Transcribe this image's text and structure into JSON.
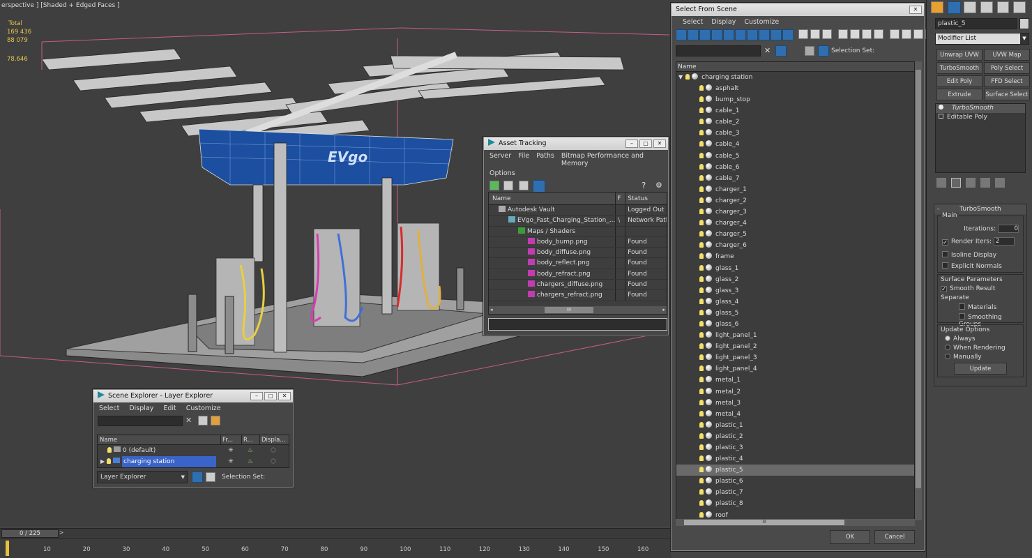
{
  "viewport": {
    "label": "erspective ] [Shaded + Edged Faces ]",
    "stats": {
      "total_label": "Total",
      "polys": "169 436",
      "verts": "88 079"
    },
    "fps": "78.646",
    "brand_text": "EVgo"
  },
  "timeline": {
    "frame": "0 / 225",
    "next": ">",
    "ticks": [
      "10",
      "20",
      "30",
      "40",
      "50",
      "60",
      "70",
      "80",
      "90",
      "100",
      "110",
      "120",
      "130",
      "140",
      "150",
      "160"
    ]
  },
  "scene_explorer": {
    "title": "Scene Explorer - Layer Explorer",
    "menu": [
      "Select",
      "Display",
      "Edit",
      "Customize"
    ],
    "headers": [
      "Name",
      "Fr...",
      "R...",
      "Displa..."
    ],
    "rows": [
      {
        "name": "0 (default)"
      },
      {
        "name": "charging station"
      }
    ],
    "footer_dropdown": "Layer Explorer",
    "selection_set_label": "Selection Set:"
  },
  "asset_tracking": {
    "title": "Asset Tracking",
    "menu": [
      "Server",
      "File",
      "Paths",
      "Bitmap Performance and Memory"
    ],
    "menu2": "Options",
    "headers": [
      "Name",
      "F",
      "Status"
    ],
    "rows": [
      {
        "name": "Autodesk Vault",
        "f": "",
        "status": "Logged Out ..."
      },
      {
        "name": "EVgo_Fast_Charging_Station_...",
        "f": "\\",
        "status": "Network Path"
      },
      {
        "name": "Maps / Shaders",
        "f": "",
        "status": ""
      },
      {
        "name": "body_bump.png",
        "f": "",
        "status": "Found"
      },
      {
        "name": "body_diffuse.png",
        "f": "",
        "status": "Found"
      },
      {
        "name": "body_reflect.png",
        "f": "",
        "status": "Found"
      },
      {
        "name": "body_refract.png",
        "f": "",
        "status": "Found"
      },
      {
        "name": "chargers_diffuse.png",
        "f": "",
        "status": "Found"
      },
      {
        "name": "chargers_refract.png",
        "f": "",
        "status": "Found"
      }
    ],
    "scroll_mark": "III"
  },
  "select_from_scene": {
    "title": "Select From Scene",
    "menu": [
      "Select",
      "Display",
      "Customize"
    ],
    "selection_set_label": "Selection Set:",
    "header": "Name",
    "root": "charging station",
    "items": [
      "asphalt",
      "bump_stop",
      "cable_1",
      "cable_2",
      "cable_3",
      "cable_4",
      "cable_5",
      "cable_6",
      "cable_7",
      "charger_1",
      "charger_2",
      "charger_3",
      "charger_4",
      "charger_5",
      "charger_6",
      "frame",
      "glass_1",
      "glass_2",
      "glass_3",
      "glass_4",
      "glass_5",
      "glass_6",
      "light_panel_1",
      "light_panel_2",
      "light_panel_3",
      "light_panel_4",
      "metal_1",
      "metal_2",
      "metal_3",
      "metal_4",
      "plastic_1",
      "plastic_2",
      "plastic_3",
      "plastic_4",
      "plastic_5",
      "plastic_6",
      "plastic_7",
      "plastic_8",
      "roof"
    ],
    "selected": "plastic_5",
    "ok": "OK",
    "cancel": "Cancel",
    "scroll_mark": "III"
  },
  "command_panel": {
    "object_name": "plastic_5",
    "modifier_list": "Modifier List",
    "buttons": [
      "Unwrap UVW",
      "UVW Map",
      "TurboSmooth",
      "Poly Select",
      "Edit Poly",
      "FFD Select",
      "Extrude",
      "Surface Select"
    ],
    "stack": [
      "TurboSmooth",
      "Editable Poly"
    ],
    "rollout_title": "TurboSmooth",
    "main_label": "Main",
    "iterations_label": "Iterations:",
    "iterations": "0",
    "render_iters_label": "Render Iters:",
    "render_iters": "2",
    "isoline": "Isoline Display",
    "explicit": "Explicit Normals",
    "surface_params": "Surface Parameters",
    "smooth_result": "Smooth Result",
    "separate": "Separate",
    "materials": "Materials",
    "smoothing_groups": "Smoothing Groups",
    "update_options": "Update Options",
    "always": "Always",
    "when_rendering": "When Rendering",
    "manually": "Manually",
    "update": "Update"
  }
}
